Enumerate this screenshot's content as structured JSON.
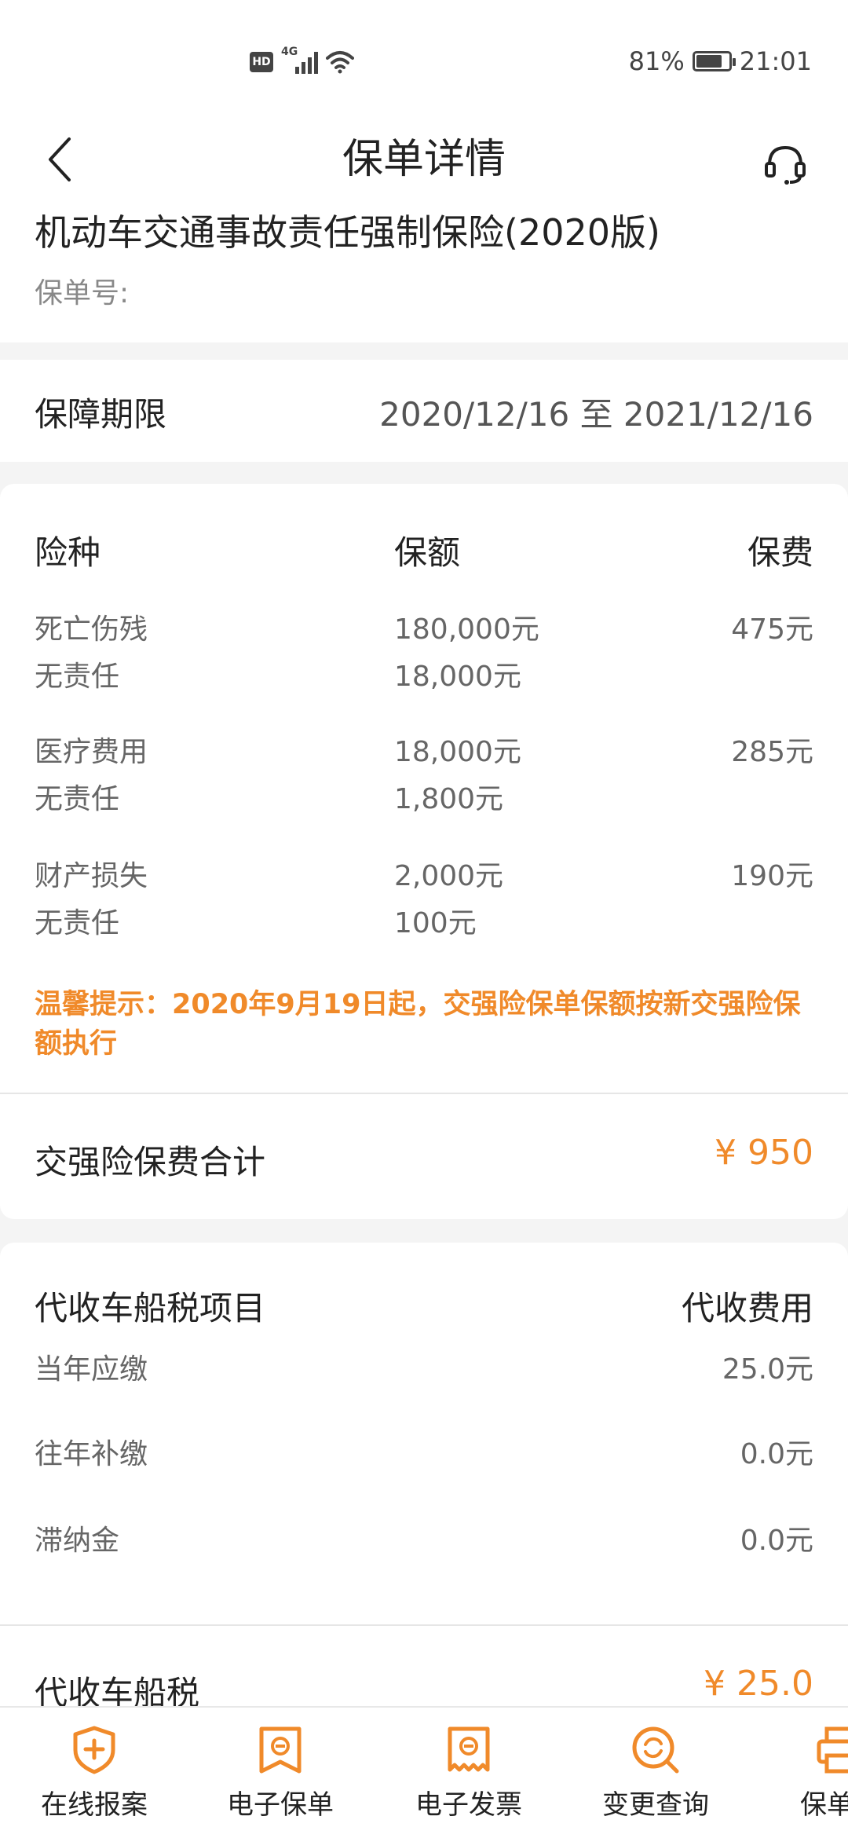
{
  "status_bar": {
    "network": "4G",
    "badge": "HD",
    "battery": "81%",
    "battery_level": 0.81,
    "time": "21:01"
  },
  "nav": {
    "title": "保单详情",
    "back_icon": "chevron-left-icon",
    "service_icon": "headset-icon"
  },
  "policy": {
    "name": "机动车交通事故责任强制保险(2020版)",
    "number_label": "保单号:"
  },
  "period": {
    "label": "保障期限",
    "value": "2020/12/16 至 2021/12/16"
  },
  "coverage": {
    "headers": [
      "险种",
      "保额",
      "保费"
    ],
    "rows": [
      {
        "type": "死亡伤残",
        "amount": "180,000元",
        "premium": "475元",
        "sub_type": "无责任",
        "sub_amount": "18,000元"
      },
      {
        "type": "医疗费用",
        "amount": "18,000元",
        "premium": "285元",
        "sub_type": "无责任",
        "sub_amount": "1,800元"
      },
      {
        "type": "财产损失",
        "amount": "2,000元",
        "premium": "190元",
        "sub_type": "无责任",
        "sub_amount": "100元"
      }
    ],
    "tip": "温馨提示：2020年9月19日起，交强险保单保额按新交强险保额执行",
    "total_label": "交强险保费合计",
    "total_value": "¥ 950"
  },
  "tax": {
    "header_left": "代收车船税项目",
    "header_right": "代收费用",
    "rows": [
      {
        "label": "当年应缴",
        "value": "25.0元"
      },
      {
        "label": "往年补缴",
        "value": "0.0元"
      },
      {
        "label": "滞纳金",
        "value": "0.0元"
      }
    ],
    "total_label": "代收车船税",
    "total_value": "¥ 25.0"
  },
  "bottom_tabs": [
    {
      "label": "在线报案",
      "icon": "shield-plus-icon"
    },
    {
      "label": "电子保单",
      "icon": "e-policy-icon"
    },
    {
      "label": "电子发票",
      "icon": "e-invoice-icon"
    },
    {
      "label": "变更查询",
      "icon": "change-query-icon"
    },
    {
      "label": "保单打",
      "icon": "printer-icon"
    }
  ],
  "colors": {
    "accent": "#f08a2a",
    "text": "#222222",
    "muted": "#666666",
    "background": "#f4f4f4"
  }
}
